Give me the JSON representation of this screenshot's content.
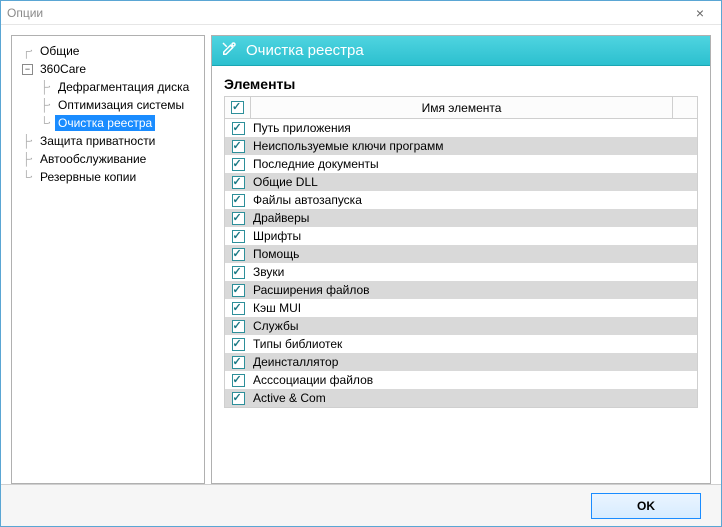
{
  "window": {
    "title": "Опции",
    "close_glyph": "×"
  },
  "tree": {
    "items": [
      {
        "label": "Общие",
        "depth": 0,
        "connector": "┌‧",
        "toggle": null
      },
      {
        "label": "360Care",
        "depth": 0,
        "connector": "",
        "toggle": "−"
      },
      {
        "label": "Дефрагментация диска",
        "depth": 1,
        "connector": "├‧",
        "toggle": null
      },
      {
        "label": "Оптимизация системы",
        "depth": 1,
        "connector": "├‧",
        "toggle": null
      },
      {
        "label": "Очистка реестра",
        "depth": 1,
        "connector": "└‧",
        "toggle": null,
        "selected": true
      },
      {
        "label": "Защита приватности",
        "depth": 0,
        "connector": "├‧",
        "toggle": null
      },
      {
        "label": "Автообслуживание",
        "depth": 0,
        "connector": "├‧",
        "toggle": null
      },
      {
        "label": "Резервные копии",
        "depth": 0,
        "connector": "└‧",
        "toggle": null
      }
    ]
  },
  "section": {
    "title": "Очистка реестра",
    "heading": "Элементы",
    "header_all_checked": true,
    "column_name": "Имя элемента",
    "items": [
      {
        "label": "Путь приложения",
        "checked": true
      },
      {
        "label": "Неиспользуемые ключи программ",
        "checked": true
      },
      {
        "label": "Последние документы",
        "checked": true
      },
      {
        "label": "Общие DLL",
        "checked": true
      },
      {
        "label": "Файлы автозапуска",
        "checked": true
      },
      {
        "label": "Драйверы",
        "checked": true
      },
      {
        "label": "Шрифты",
        "checked": true
      },
      {
        "label": "Помощь",
        "checked": true
      },
      {
        "label": "Звуки",
        "checked": true
      },
      {
        "label": "Расширения файлов",
        "checked": true
      },
      {
        "label": "Кэш MUI",
        "checked": true
      },
      {
        "label": "Службы",
        "checked": true
      },
      {
        "label": "Типы библиотек",
        "checked": true
      },
      {
        "label": "Деинсталлятор",
        "checked": true
      },
      {
        "label": "Асссоциации файлов",
        "checked": true
      },
      {
        "label": "Active & Com",
        "checked": true
      }
    ]
  },
  "footer": {
    "ok_label": "OK"
  }
}
